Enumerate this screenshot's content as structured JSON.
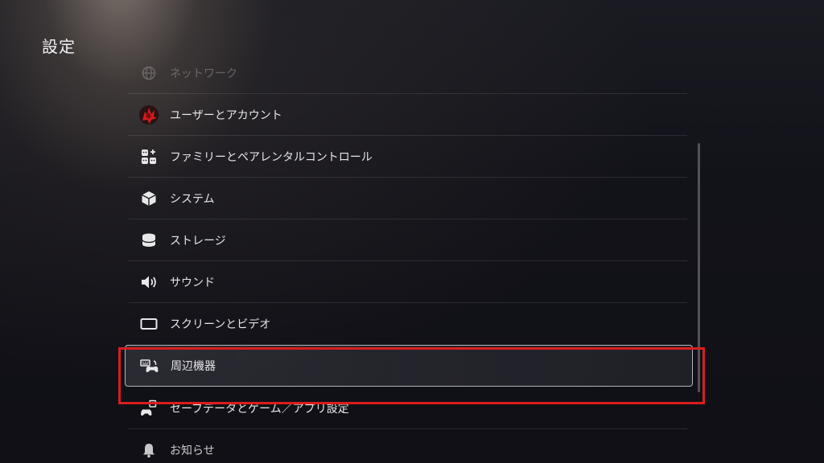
{
  "page": {
    "title": "設定"
  },
  "menu": {
    "items": [
      {
        "label": "ネットワーク",
        "icon": "globe-icon"
      },
      {
        "label": "ユーザーとアカウント",
        "icon": "user-avatar-icon"
      },
      {
        "label": "ファミリーとペアレンタルコントロール",
        "icon": "family-icon"
      },
      {
        "label": "システム",
        "icon": "system-cube-icon"
      },
      {
        "label": "ストレージ",
        "icon": "storage-icon"
      },
      {
        "label": "サウンド",
        "icon": "speaker-icon"
      },
      {
        "label": "スクリーンとビデオ",
        "icon": "screen-icon"
      },
      {
        "label": "周辺機器",
        "icon": "accessories-icon",
        "focused": true
      },
      {
        "label": "セーブデータとゲーム／アプリ設定",
        "icon": "saved-data-icon"
      },
      {
        "label": "お知らせ",
        "icon": "bell-icon"
      }
    ]
  },
  "annotation": {
    "highlight_color": "#d81e1e"
  }
}
